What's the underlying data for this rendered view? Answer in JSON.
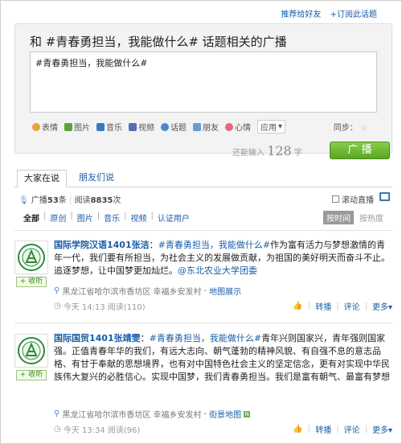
{
  "header_links": {
    "recommend": "推荐给好友",
    "subscribe": "+订阅此话题"
  },
  "composer": {
    "title": "和 #青春勇担当，我能做什么# 话题相关的广播",
    "text": "#青春勇担当，我能做什么#",
    "toolbar": [
      {
        "label": "表情",
        "icon": "smiley-icon",
        "color": "#e8a33a"
      },
      {
        "label": "图片",
        "icon": "image-icon",
        "color": "#5aa33a"
      },
      {
        "label": "音乐",
        "icon": "music-icon",
        "color": "#3a7ac4"
      },
      {
        "label": "视频",
        "icon": "video-icon",
        "color": "#5a6ab4"
      },
      {
        "label": "话题",
        "icon": "topic-icon",
        "color": "#4a8ad4"
      },
      {
        "label": "朋友",
        "icon": "friend-icon",
        "color": "#6a9ad4"
      },
      {
        "label": "心情",
        "icon": "heart-icon",
        "color": "#e26a7a"
      },
      {
        "label": "应用",
        "icon": "app-dropdown-icon",
        "color": "#888888"
      }
    ],
    "sync_label": "同步：",
    "counter_prefix": "还能输入",
    "counter_value": "128",
    "counter_suffix": "字",
    "post_button": "广 播"
  },
  "tabs": [
    {
      "label": "大家在说",
      "active": true
    },
    {
      "label": "朋友们说",
      "active": false
    }
  ],
  "stats": {
    "broadcast_label": "广播",
    "broadcast_count": "53",
    "broadcast_unit": "条",
    "read_label": "阅读",
    "read_count": "8835",
    "read_unit": "次",
    "scroll_live": "滚动直播"
  },
  "filters": [
    "全部",
    "原创",
    "图片",
    "音乐",
    "视频",
    "认证用户"
  ],
  "sort": {
    "by_time": "按时间",
    "by_heat": "按热度"
  },
  "feed": [
    {
      "author": "国际学院汉语1401张洁",
      "topic": "#青春勇担当，我能做什么#",
      "text": "作为富有活力与梦想激情的青年一代，我们要有所担当，为社会主义的发展做贡献，为祖国的美好明天而奋斗不止。追逐梦想，让中国梦更加灿烂。",
      "mention": "@东北农业大学团委",
      "follow": "+ 收听",
      "location": "黑龙江省哈尔滨市香坊区 幸福乡安发村",
      "map_link": "地图展示",
      "time": "今天 14:13",
      "reads": "阅读(110)",
      "actions": [
        "转播",
        "评论",
        "更多"
      ]
    },
    {
      "author": "国际国贸1401张靖雯",
      "topic": "#青春勇担当，我能做什么#",
      "text": "青年兴则国家兴，青年强则国家强。正值青春年华的我们，有远大志向、朝气蓬勃的精神风貌、有自强不息的意志品格、有甘于奉献的思想境界，也有对中国特色社会主义的坚定信念，更有对实现中华民族伟大复兴的必胜信心。实现中国梦，我们青春勇担当。我们是富有朝气、最富有梦想",
      "mention": "",
      "follow": "+ 收听",
      "location": "黑龙江省哈尔滨市香坊区 幸福乡安发村",
      "map_link": "街景地图",
      "time": "今天 13:34",
      "reads": "阅读(96)",
      "actions": [
        "转播",
        "评论",
        "更多"
      ]
    }
  ]
}
